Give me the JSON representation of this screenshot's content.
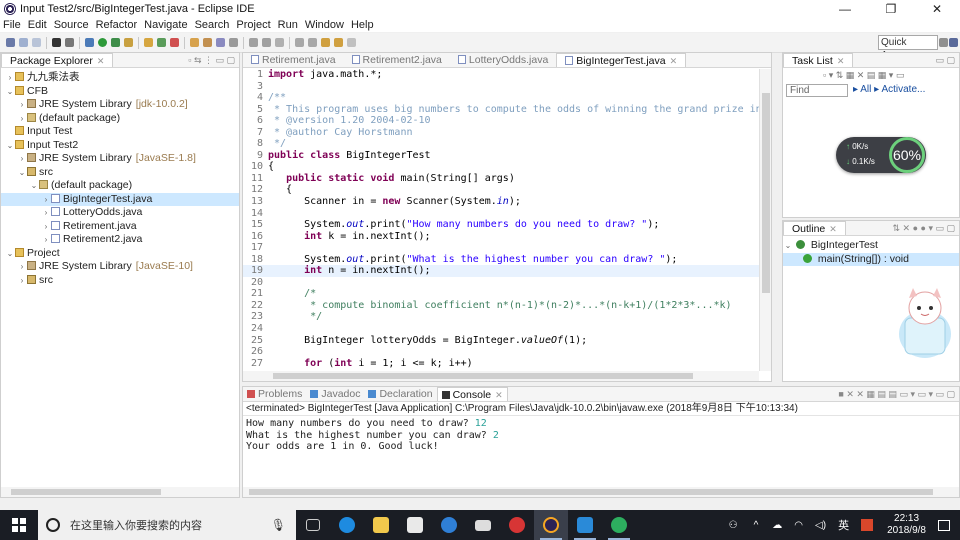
{
  "window": {
    "title": "Input Test2/src/BigIntegerTest.java - Eclipse IDE",
    "minimize": "—",
    "restore": "❐",
    "close": "✕"
  },
  "menu": [
    "File",
    "Edit",
    "Source",
    "Refactor",
    "Navigate",
    "Search",
    "Project",
    "Run",
    "Window",
    "Help"
  ],
  "toolbar": {
    "quick_access": "Quick Access"
  },
  "package_explorer": {
    "title": "Package Explorer",
    "items": [
      {
        "label": "九九乘法表",
        "depth": 0,
        "arrow": "›",
        "icon": "project-icon"
      },
      {
        "label": "CFB",
        "depth": 0,
        "arrow": "⌄",
        "icon": "project-icon"
      },
      {
        "label": "JRE System Library",
        "suffix": "[jdk-10.0.2]",
        "depth": 1,
        "arrow": "›",
        "icon": "library-icon"
      },
      {
        "label": "(default package)",
        "depth": 1,
        "arrow": "›",
        "icon": "package-icon"
      },
      {
        "label": "Input Test",
        "depth": 0,
        "arrow": "",
        "icon": "project-icon"
      },
      {
        "label": "Input Test2",
        "depth": 0,
        "arrow": "⌄",
        "icon": "project-icon"
      },
      {
        "label": "JRE System Library",
        "suffix": "[JavaSE-1.8]",
        "depth": 1,
        "arrow": "›",
        "icon": "library-icon"
      },
      {
        "label": "src",
        "depth": 1,
        "arrow": "⌄",
        "icon": "source-folder-icon"
      },
      {
        "label": "(default package)",
        "depth": 2,
        "arrow": "⌄",
        "icon": "package-icon"
      },
      {
        "label": "BigIntegerTest.java",
        "depth": 3,
        "arrow": "›",
        "icon": "java-file-icon",
        "selected": true
      },
      {
        "label": "LotteryOdds.java",
        "depth": 3,
        "arrow": "›",
        "icon": "java-file-icon"
      },
      {
        "label": "Retirement.java",
        "depth": 3,
        "arrow": "›",
        "icon": "java-file-icon"
      },
      {
        "label": "Retirement2.java",
        "depth": 3,
        "arrow": "›",
        "icon": "java-file-icon"
      },
      {
        "label": "Project",
        "depth": 0,
        "arrow": "⌄",
        "icon": "project-icon"
      },
      {
        "label": "JRE System Library",
        "suffix": "[JavaSE-10]",
        "depth": 1,
        "arrow": "›",
        "icon": "library-icon"
      },
      {
        "label": "src",
        "depth": 1,
        "arrow": "›",
        "icon": "source-folder-icon"
      }
    ]
  },
  "editor": {
    "tabs": [
      {
        "label": "Retirement.java",
        "active": false
      },
      {
        "label": "Retirement2.java",
        "active": false
      },
      {
        "label": "LotteryOdds.java",
        "active": false
      },
      {
        "label": "BigIntegerTest.java",
        "active": true
      }
    ],
    "lines": [
      {
        "n": "1",
        "html": "<span class=\"k\">import</span> java.math.*;"
      },
      {
        "n": "3",
        "html": ""
      },
      {
        "n": "4",
        "html": "<span class=\"cj\">/**</span>"
      },
      {
        "n": "5",
        "html": "<span class=\"cj\"> * This program uses big numbers to compute the odds of winning the grand prize in a lotte</span>"
      },
      {
        "n": "6",
        "html": "<span class=\"cj\"> * @version 1.20 2004-02-10</span>"
      },
      {
        "n": "7",
        "html": "<span class=\"cj\"> * @author Cay Horstmann</span>"
      },
      {
        "n": "8",
        "html": "<span class=\"cj\"> */</span>"
      },
      {
        "n": "9",
        "html": "<span class=\"k\">public class</span> BigIntegerTest"
      },
      {
        "n": "10",
        "html": "{"
      },
      {
        "n": "11",
        "html": "   <span class=\"k\">public static void</span> main(String[] args)"
      },
      {
        "n": "12",
        "html": "   {"
      },
      {
        "n": "13",
        "html": "      Scanner in = <span class=\"k\">new</span> Scanner(System.<span class=\"f\">in</span>);"
      },
      {
        "n": "14",
        "html": ""
      },
      {
        "n": "15",
        "html": "      System.<span class=\"f\">out</span>.print(<span class=\"s\">\"How many numbers do you need to draw? \"</span>);"
      },
      {
        "n": "16",
        "html": "      <span class=\"k\">int</span> k = in.nextInt();"
      },
      {
        "n": "17",
        "html": ""
      },
      {
        "n": "18",
        "html": "      System.<span class=\"f\">out</span>.print(<span class=\"s\">\"What is the highest number you can draw? \"</span>);"
      },
      {
        "n": "19",
        "html": "      <span class=\"k\">int</span> n = in.nextInt();",
        "current": true
      },
      {
        "n": "20",
        "html": ""
      },
      {
        "n": "21",
        "html": "      <span class=\"c\">/*</span>"
      },
      {
        "n": "22",
        "html": "<span class=\"c\">       * compute binomial coefficient n*(n-1)*(n-2)*...*(n-k+1)/(1*2*3*...*k)</span>"
      },
      {
        "n": "23",
        "html": "<span class=\"c\">       */</span>"
      },
      {
        "n": "24",
        "html": ""
      },
      {
        "n": "25",
        "html": "      BigInteger lotteryOdds = BigInteger.<span class=\"m\">valueOf</span>(1);"
      },
      {
        "n": "26",
        "html": ""
      },
      {
        "n": "27",
        "html": "      <span class=\"k\">for</span> (<span class=\"k\">int</span> i = 1; i &lt;= k; i++)"
      }
    ]
  },
  "task_list": {
    "title": "Task List",
    "find_placeholder": "Find",
    "all": "All",
    "activate": "Activate..."
  },
  "outline": {
    "title": "Outline",
    "class_name": "BigIntegerTest",
    "method": "main(String[]) : void"
  },
  "speed_widget": {
    "up": "0K/s",
    "down": "0.1K/s",
    "percent": "60%"
  },
  "bottom_tabs": [
    {
      "label": "Problems",
      "active": false
    },
    {
      "label": "Javadoc",
      "active": false
    },
    {
      "label": "Declaration",
      "active": false
    },
    {
      "label": "Console",
      "active": true
    }
  ],
  "console": {
    "terminated": "<terminated> BigIntegerTest [Java Application] C:\\Program Files\\Java\\jdk-10.0.2\\bin\\javaw.exe (2018年9月8日 下午10:13:34)",
    "lines": [
      {
        "text": "How many numbers do you need to draw? ",
        "input": "12"
      },
      {
        "text": "What is the highest number you can draw? ",
        "input": "2"
      },
      {
        "text": "Your odds are 1 in 0. Good luck!",
        "input": ""
      }
    ]
  },
  "taskbar": {
    "search_placeholder": "在这里输入你要搜索的内容",
    "time": "22:13",
    "date": "2018/9/8",
    "ime": "英"
  }
}
